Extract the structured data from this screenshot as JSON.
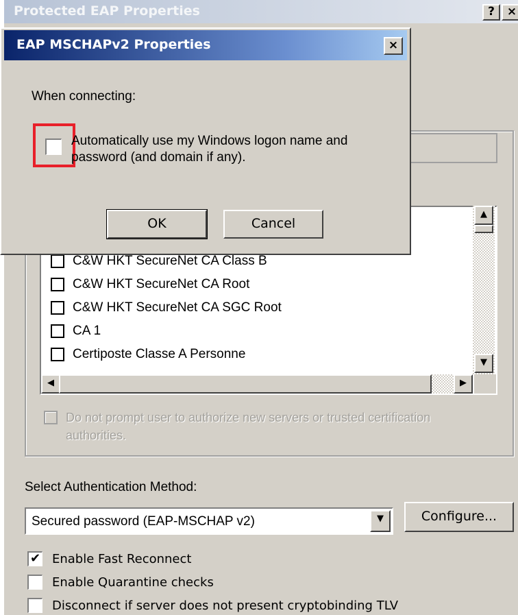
{
  "parent_dialog": {
    "title": "Protected EAP Properties",
    "help_label": "?",
    "close_label": "×",
    "ca_list": [
      {
        "label": "C&W HKT SecureNet CA Class B",
        "checked": false
      },
      {
        "label": "C&W HKT SecureNet CA Root",
        "checked": false
      },
      {
        "label": "C&W HKT SecureNet CA SGC Root",
        "checked": false
      },
      {
        "label": "CA 1",
        "checked": false
      },
      {
        "label": "Certiposte Classe A Personne",
        "checked": false
      }
    ],
    "no_prompt_label": "Do not prompt user to authorize new servers or trusted certification authorities.",
    "auth_method_label": "Select Authentication Method:",
    "auth_method_value": "Secured password (EAP-MSCHAP v2)",
    "configure_label": "Configure...",
    "options": [
      {
        "label": "Enable Fast Reconnect",
        "checked": true
      },
      {
        "label": "Enable Quarantine checks",
        "checked": false
      },
      {
        "label": "Disconnect if server does not present cryptobinding TLV",
        "checked": false
      }
    ]
  },
  "child_dialog": {
    "title": "EAP MSCHAPv2 Properties",
    "close_label": "×",
    "when_connecting_label": "When connecting:",
    "auto_logon_label": "Automatically use my Windows logon name and password (and domain if any).",
    "auto_logon_checked": false,
    "ok_label": "OK",
    "cancel_label": "Cancel"
  },
  "colors": {
    "dialog_bg": "#d4d0c8",
    "active_title": "#0a246a",
    "highlight": "#e8202a"
  }
}
